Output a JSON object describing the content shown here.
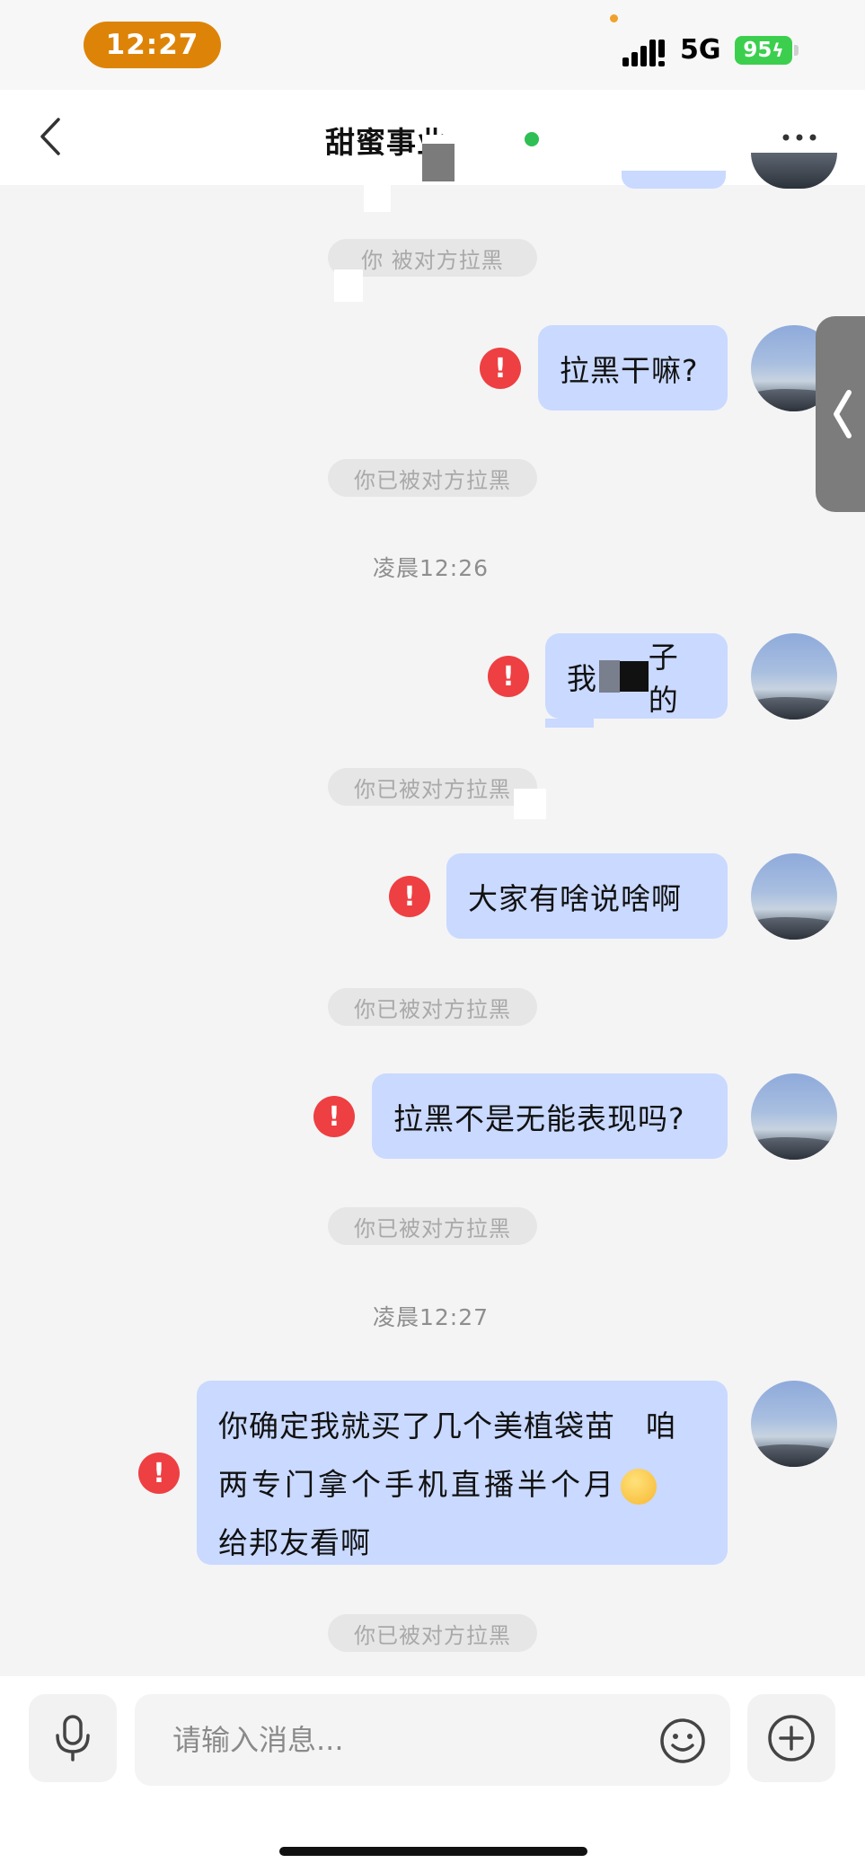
{
  "status_bar": {
    "time": "12:27",
    "network": "5G",
    "battery": "95"
  },
  "header": {
    "title": "甜蜜事业",
    "back_icon": "chevron-left-icon",
    "more_icon": "more-dots-icon"
  },
  "messages": {
    "sys_blocked_partial": "你 被对方拉黑",
    "msg1": "拉黑干嘛?",
    "sys_blocked_1": "你已被对方拉黑",
    "time_1": "凌晨12:26",
    "msg2_start": "我",
    "msg2_end": "子的",
    "sys_blocked_2": "你已被对方拉黑",
    "msg3": "大家有啥说啥啊",
    "sys_blocked_3": "你已被对方拉黑",
    "msg4": "拉黑不是无能表现吗?",
    "sys_blocked_4": "你已被对方拉黑",
    "time_2": "凌晨12:27",
    "msg5_line1": "你确定我就买了几个美植袋苗　咱",
    "msg5_line2": "两专门拿个手机直播半个月",
    "msg5_line3": "给邦友看啊",
    "sys_blocked_5": "你已被对方拉黑",
    "error_icon_text": "!"
  },
  "input": {
    "placeholder": "请输入消息...",
    "mic_icon": "microphone-icon",
    "emoji_icon": "emoji-smile-icon",
    "plus_icon": "plus-circle-icon"
  },
  "colors": {
    "bubble": "#c9d9ff",
    "error": "#ee3f42",
    "time_pill": "#dd8408",
    "battery": "#3ccf4e",
    "online": "#2fbf55"
  }
}
